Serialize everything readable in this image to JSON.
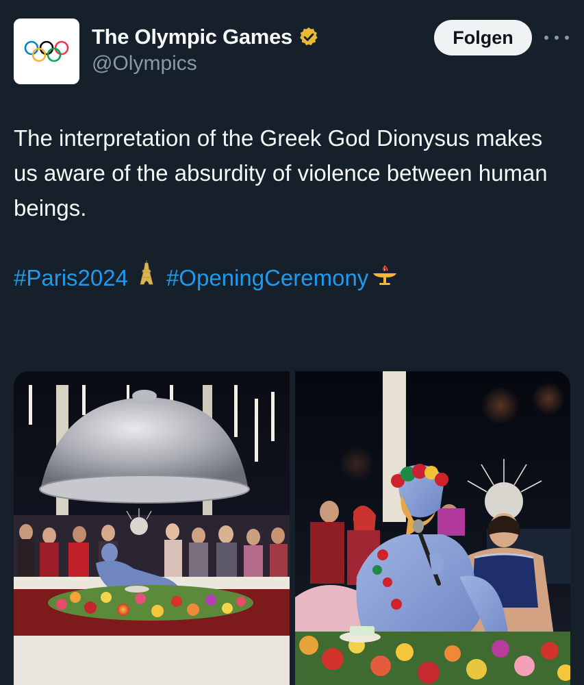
{
  "author": {
    "display_name": "The Olympic Games",
    "handle": "@Olympics",
    "verified": true,
    "avatar_icon": "olympic-rings-icon",
    "badge_icon": "verified-gold-badge-icon"
  },
  "actions": {
    "follow_label": "Folgen",
    "more_icon": "more-dots-icon"
  },
  "tweet": {
    "text": "The interpretation of the Greek God Dionysus makes us aware of the absurdity of violence between human beings.",
    "hashtags": [
      {
        "tag": "#Paris2024",
        "emoji": "eiffel-tower-icon"
      },
      {
        "tag": "#OpeningCeremony",
        "emoji": "olympic-cauldron-icon"
      }
    ]
  },
  "media": {
    "count": 2,
    "photos": [
      {
        "subject": "long table scene with silver cloche dome and blue painted performer on flower bed",
        "icon": "photo-1"
      },
      {
        "subject": "close-up of blue painted performer with flower crown singing into microphone",
        "icon": "photo-2"
      }
    ]
  },
  "colors": {
    "background": "#15202b",
    "text": "#f7f9f9",
    "secondary": "#8b98a5",
    "link": "#1d9bf0",
    "verified_gold": "#e8b931"
  }
}
